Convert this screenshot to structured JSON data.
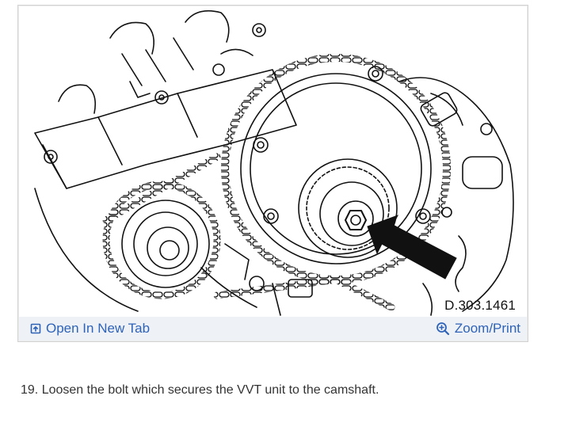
{
  "figure": {
    "id_label": "D.303.1461",
    "open_tab_label": "Open In New Tab",
    "zoom_label": "Zoom/Print",
    "open_tab_icon": "open-in-new-tab-icon",
    "zoom_icon": "zoom-in-icon",
    "link_color": "#2e63b8"
  },
  "instruction": {
    "text": "19. Loosen the bolt which secures the VVT unit to the camshaft."
  }
}
